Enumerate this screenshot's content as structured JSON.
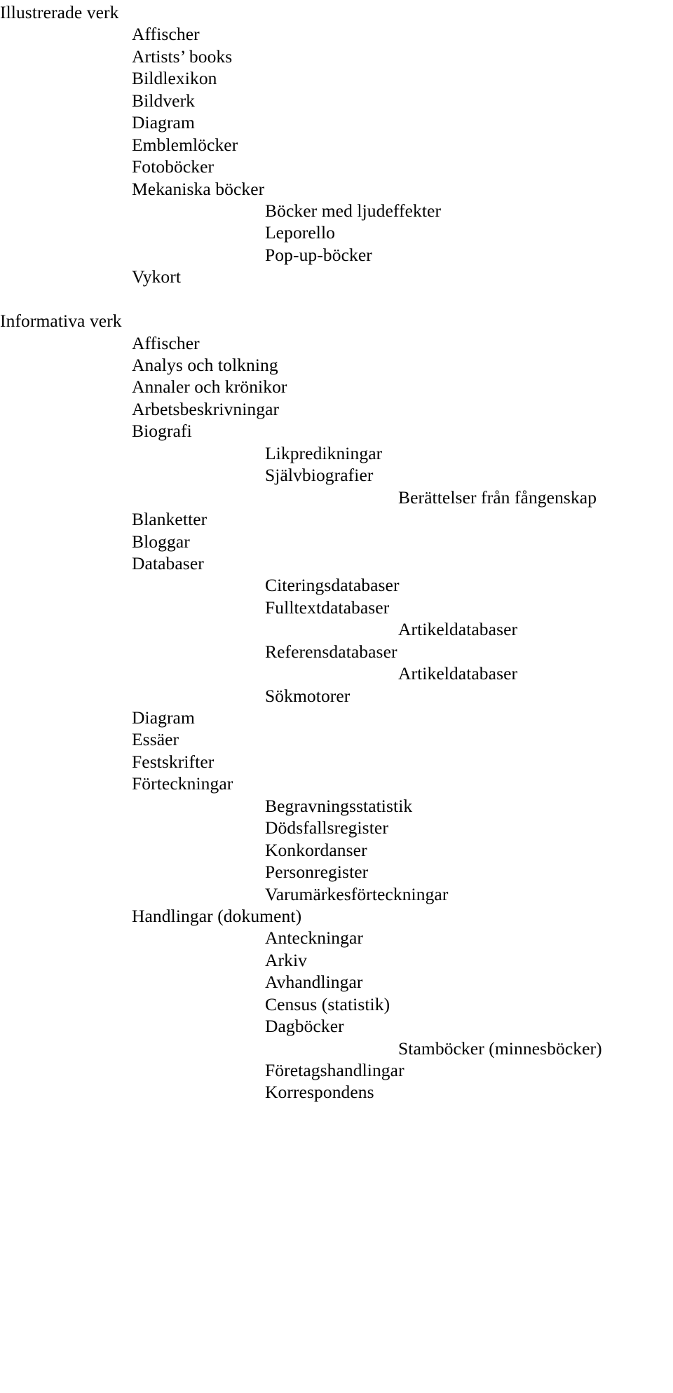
{
  "document": {
    "type": "hierarchical-outline",
    "language": "sv",
    "text_color": "#000000",
    "background_color": "#ffffff",
    "indent_levels": [
      0,
      1,
      2,
      3
    ],
    "lines": [
      {
        "level": 0,
        "text": "Illustrerade verk"
      },
      {
        "level": 1,
        "text": "Affischer"
      },
      {
        "level": 1,
        "text": "Artists’ books"
      },
      {
        "level": 1,
        "text": "Bildlexikon"
      },
      {
        "level": 1,
        "text": "Bildverk"
      },
      {
        "level": 1,
        "text": "Diagram"
      },
      {
        "level": 1,
        "text": "Emblemlöcker"
      },
      {
        "level": 1,
        "text": "Fotoböcker"
      },
      {
        "level": 1,
        "text": "Mekaniska böcker"
      },
      {
        "level": 2,
        "text": "Böcker med ljudeffekter"
      },
      {
        "level": 2,
        "text": "Leporello"
      },
      {
        "level": 2,
        "text": "Pop-up-böcker"
      },
      {
        "level": 1,
        "text": "Vykort"
      },
      {
        "level": -1,
        "text": ""
      },
      {
        "level": 0,
        "text": "Informativa verk"
      },
      {
        "level": 1,
        "text": "Affischer"
      },
      {
        "level": 1,
        "text": "Analys och tolkning"
      },
      {
        "level": 1,
        "text": "Annaler och krönikor"
      },
      {
        "level": 1,
        "text": "Arbetsbeskrivningar"
      },
      {
        "level": 1,
        "text": "Biografi"
      },
      {
        "level": 2,
        "text": "Likpredikningar"
      },
      {
        "level": 2,
        "text": "Självbiografier"
      },
      {
        "level": 3,
        "text": "Berättelser från fångenskap"
      },
      {
        "level": 1,
        "text": "Blanketter"
      },
      {
        "level": 1,
        "text": "Bloggar"
      },
      {
        "level": 1,
        "text": "Databaser"
      },
      {
        "level": 2,
        "text": "Citeringsdatabaser"
      },
      {
        "level": 2,
        "text": "Fulltextdatabaser"
      },
      {
        "level": 3,
        "text": "Artikeldatabaser"
      },
      {
        "level": 2,
        "text": "Referensdatabaser"
      },
      {
        "level": 3,
        "text": "Artikeldatabaser"
      },
      {
        "level": 2,
        "text": "Sökmotorer"
      },
      {
        "level": 1,
        "text": "Diagram"
      },
      {
        "level": 1,
        "text": "Essäer"
      },
      {
        "level": 1,
        "text": "Festskrifter"
      },
      {
        "level": 1,
        "text": "Förteckningar"
      },
      {
        "level": 2,
        "text": "Begravningsstatistik"
      },
      {
        "level": 2,
        "text": "Dödsfallsregister"
      },
      {
        "level": 2,
        "text": "Konkordanser"
      },
      {
        "level": 2,
        "text": "Personregister"
      },
      {
        "level": 2,
        "text": "Varumärkesförteckningar"
      },
      {
        "level": 1,
        "text": "Handlingar (dokument)"
      },
      {
        "level": 2,
        "text": "Anteckningar"
      },
      {
        "level": 2,
        "text": "Arkiv"
      },
      {
        "level": 2,
        "text": "Avhandlingar"
      },
      {
        "level": 2,
        "text": "Census (statistik)"
      },
      {
        "level": 2,
        "text": "Dagböcker"
      },
      {
        "level": 3,
        "text": "Stamböcker (minnesböcker)"
      },
      {
        "level": 2,
        "text": "Företagshandlingar"
      },
      {
        "level": 2,
        "text": "Korrespondens"
      }
    ]
  }
}
